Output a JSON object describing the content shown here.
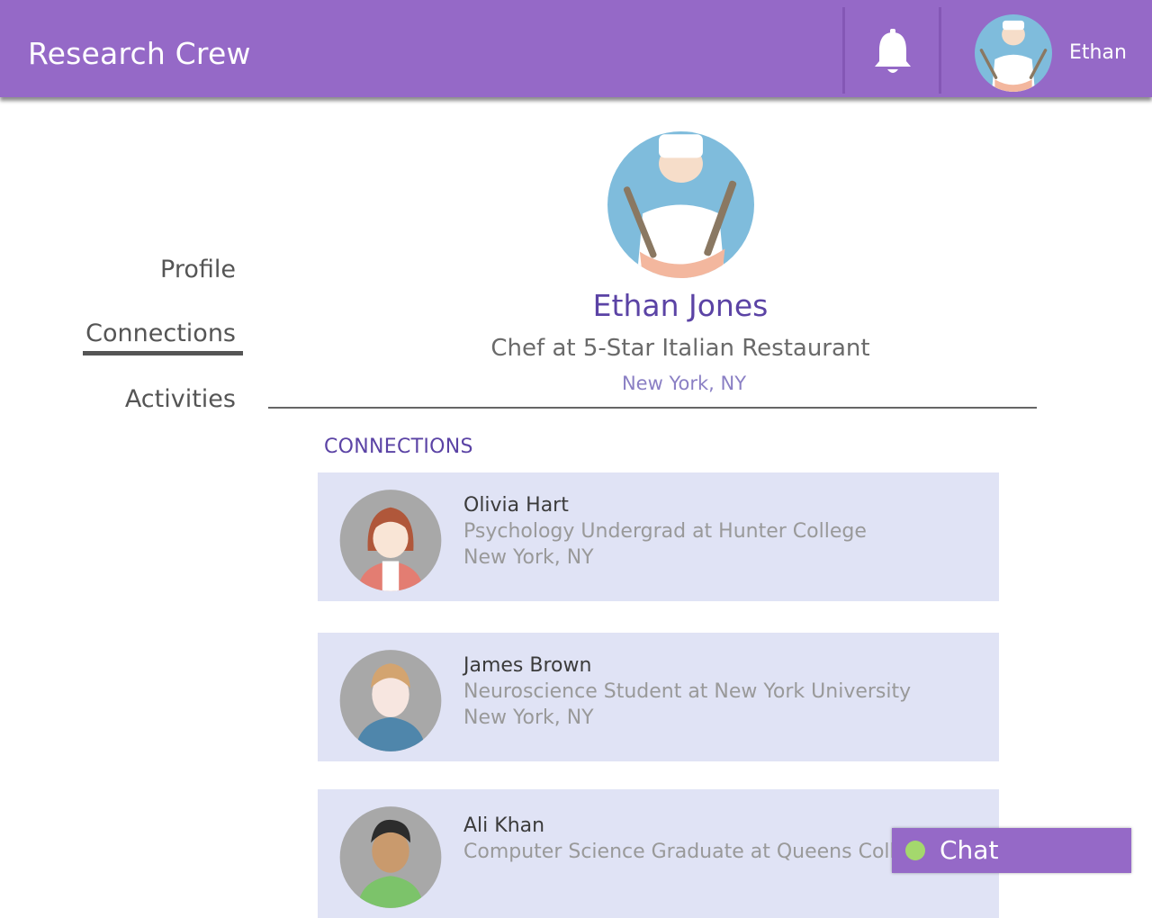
{
  "header": {
    "brand": "Research Crew",
    "notification_icon": "bell-icon",
    "user_name": "Ethan"
  },
  "nav": {
    "items": [
      {
        "label": "Profile",
        "active": false
      },
      {
        "label": "Connections",
        "active": true
      },
      {
        "label": "Activities",
        "active": false
      }
    ]
  },
  "profile": {
    "name": "Ethan Jones",
    "title": "Chef at 5-Star Italian Restaurant",
    "location": "New York, NY"
  },
  "connections": {
    "heading": "CONNECTIONS",
    "items": [
      {
        "name": "Olivia Hart",
        "role": "Psychology Undergrad at Hunter College",
        "location": "New York, NY"
      },
      {
        "name": "James Brown",
        "role": "Neuroscience Student at New York University",
        "location": "New York, NY"
      },
      {
        "name": "Ali Khan",
        "role": "Computer Science Graduate at Queens College",
        "location": ""
      }
    ]
  },
  "chat": {
    "label": "Chat",
    "status_color": "#a4d86d"
  },
  "colors": {
    "header": "#9569c7",
    "accent": "#5b43a5",
    "card_bg": "#e0e3f5"
  }
}
